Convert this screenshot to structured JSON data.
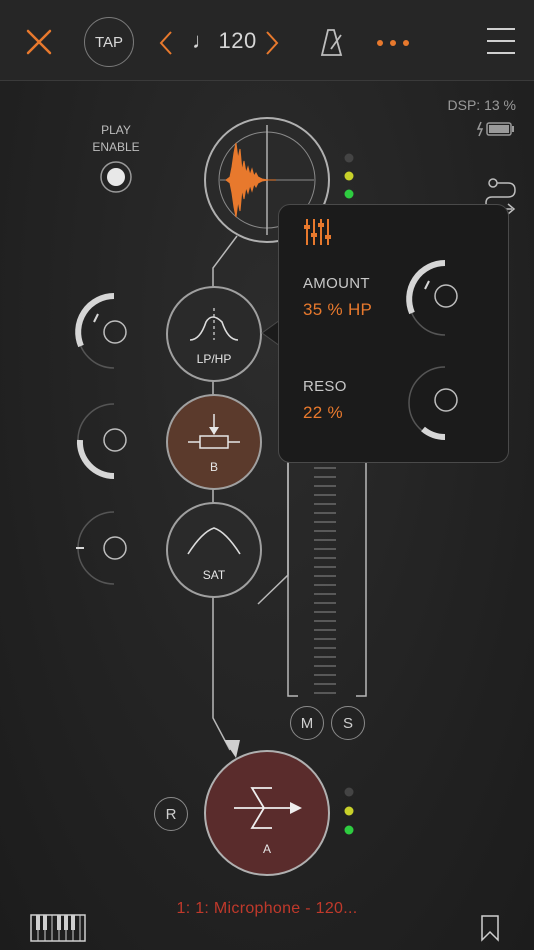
{
  "header": {
    "close_icon": "close-x-icon",
    "tap_label": "TAP",
    "tempo_note": "♩",
    "tempo_value": "120",
    "prev_icon": "chevron-left-icon",
    "next_icon": "chevron-right-icon",
    "metronome_icon": "metronome-icon",
    "more_icon": "more-dots-icon",
    "menu_icon": "hamburger-menu-icon"
  },
  "status": {
    "dsp_text": "DSP: 13 %"
  },
  "play_enable": {
    "line1": "PLAY",
    "line2": "ENABLE"
  },
  "nodes": {
    "filter_name": "LP/HP",
    "b_name": "B",
    "sat_name": "SAT",
    "mixer_name": "A"
  },
  "mixer": {
    "m_label": "M",
    "s_label": "S",
    "r_label": "R"
  },
  "popup": {
    "icon": "sliders-icon",
    "amount_label": "AMOUNT",
    "amount_value": "35 % HP",
    "reso_label": "RESO",
    "reso_value": "22 %"
  },
  "footer": {
    "track_text": "1: 1: Microphone  - 120...",
    "keyboard_icon": "piano-keyboard-icon",
    "bookmark_icon": "bookmark-icon"
  },
  "colors": {
    "accent": "#e8792d",
    "led_green": "#2ecc40",
    "led_yellow": "#c8d12a",
    "track_red": "#c0392b",
    "b_node": "#5b3a2c",
    "mixer_node": "#5a2c2c"
  }
}
